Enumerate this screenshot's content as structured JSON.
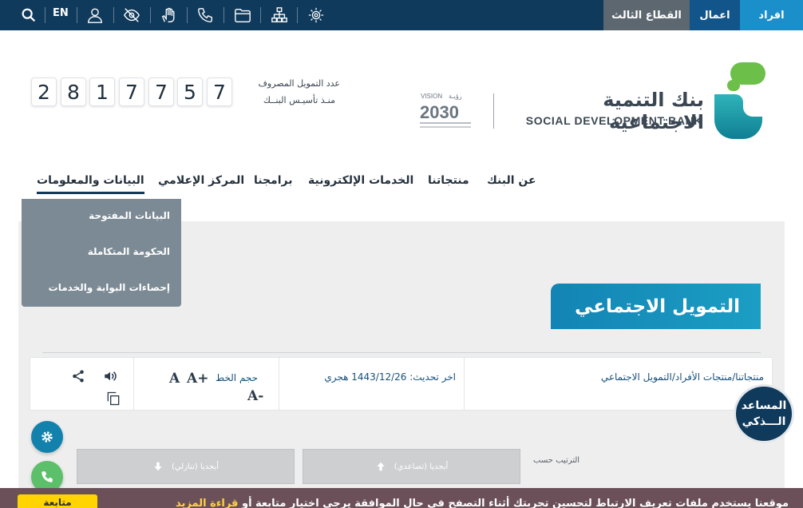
{
  "topbar": {
    "segments": {
      "individuals": "افراد",
      "business": "اعمال",
      "third_sector": "القطاع الثالث"
    },
    "lang_label": "EN",
    "icons": [
      "search-icon",
      "user-icon",
      "eye-slash-icon",
      "sign-language-icon",
      "phone-icon",
      "folder-icon",
      "sitemap-icon",
      "settings-emblem-icon"
    ]
  },
  "header": {
    "counter_label_1": "عدد التمويل المصروف",
    "counter_label_2": "منـذ تأسيـس البنــك",
    "counter_digits": [
      "2",
      "8",
      "1",
      "7",
      "7",
      "5",
      "7"
    ],
    "bank_name_ar": "بنك التنمية الاجتماعية",
    "bank_name_en": "SOCIAL DEVELOPMENT BANK",
    "vision_label": "VISION",
    "vision_year": "2030",
    "vision_ar": "رؤيـة"
  },
  "nav": {
    "items": [
      "عن البنك",
      "منتجاتنا",
      "الخدمات الإلكترونية",
      "برامجنا",
      "المركز الإعلامي",
      "البيانات والمعلومات"
    ],
    "dropdown": [
      "البيانات المفتوحة",
      "الحكومة المتكاملة",
      "إحصاءات البوابة والخدمات"
    ]
  },
  "page": {
    "title": "التمويل الاجتماعي",
    "breadcrumb": "منتجاتنا/منتجات الأفراد/التمويل الاجتماعي",
    "updated": "اخر تحديث: 1443/12/26 هجري",
    "font_size_label": "حجم الخط",
    "font_increase": "A+",
    "font_normal": "A",
    "font_decrease": "A-"
  },
  "sort": {
    "label": "الترتيب حسب",
    "asc": "أبجديا (تصاعدي)",
    "desc": "أبجديا (تنازلي)"
  },
  "assistant": {
    "line1": "المساعد",
    "line2": "الـــذكي"
  },
  "cookie": {
    "text": "موقعنا يستخدم ملفات تعريف الارتباط لتحسين تجربتك أثناء التصفح في حال الموافقة يرجى اختيار متابعة أو",
    "more": "قراءة المزيد",
    "button": "متابعة"
  },
  "colors": {
    "navy": "#0f3a5c",
    "teal": "#1a8fc9",
    "accent_yellow": "#ffd400"
  }
}
